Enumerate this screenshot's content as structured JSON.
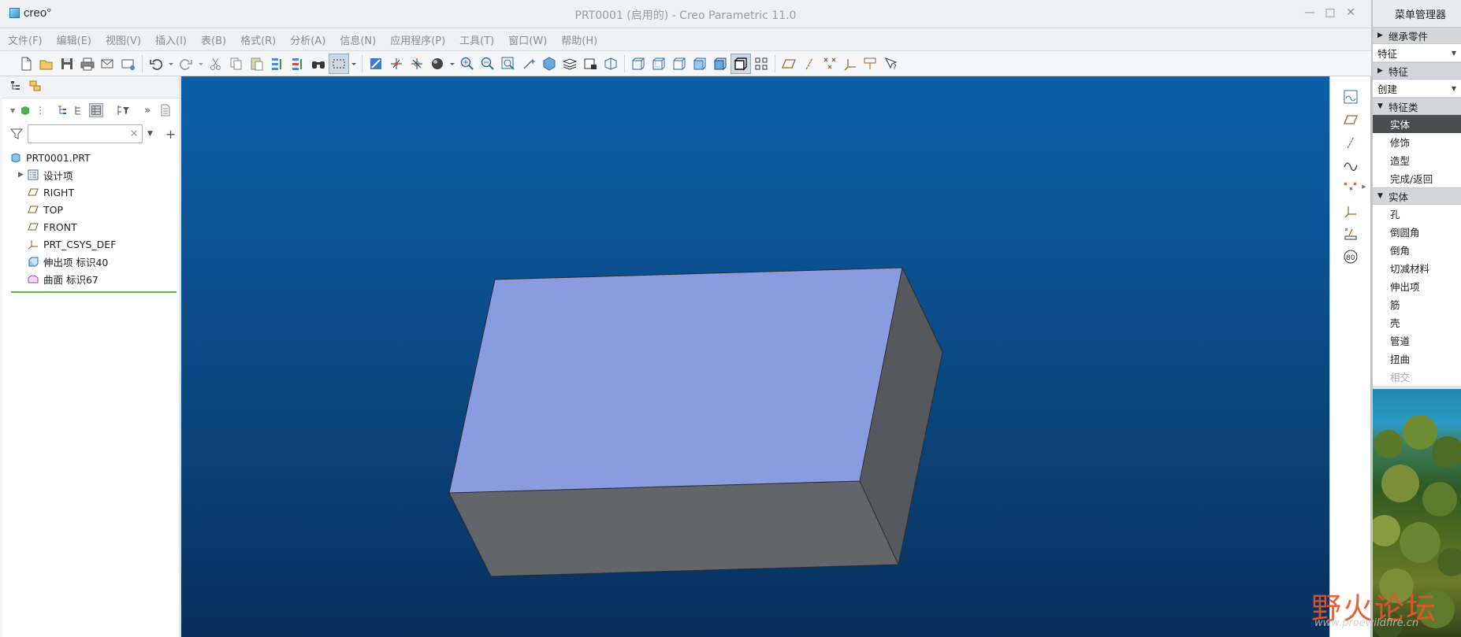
{
  "titlebar": {
    "logo_text": "creo°",
    "title": "PRT0001 (启用的) - Creo Parametric 11.0",
    "minimize": "—",
    "maximize": "□",
    "close": "✕"
  },
  "menubar": {
    "items": [
      "文件(F)",
      "编辑(E)",
      "视图(V)",
      "插入(I)",
      "表(B)",
      "格式(R)",
      "分析(A)",
      "信息(N)",
      "应用程序(P)",
      "工具(T)",
      "窗口(W)",
      "帮助(H)"
    ]
  },
  "tree": {
    "search_placeholder": "",
    "search_clear": "×",
    "add_symbol": "+",
    "more_symbol": "»",
    "nodes": [
      {
        "label": "PRT0001.PRT",
        "icon": "part-icon"
      },
      {
        "label": "设计项",
        "icon": "design-items-icon",
        "expandable": true
      },
      {
        "label": "RIGHT",
        "icon": "datum-plane-icon"
      },
      {
        "label": "TOP",
        "icon": "datum-plane-icon"
      },
      {
        "label": "FRONT",
        "icon": "datum-plane-icon"
      },
      {
        "label": "PRT_CSYS_DEF",
        "icon": "csys-icon"
      },
      {
        "label": "伸出项 标识40",
        "icon": "protrusion-icon"
      },
      {
        "label": "曲面 标识67",
        "icon": "surface-icon"
      }
    ]
  },
  "menu_manager": {
    "title": "菜单管理器",
    "sections": {
      "inherit": "继承零件",
      "feature_combo": "特征",
      "feature": "特征",
      "create_combo": "创建",
      "feature_class": "特征类",
      "solid": "实体"
    },
    "feature_class_items": [
      {
        "label": "实体",
        "selected": true
      },
      {
        "label": "修饰"
      },
      {
        "label": "造型"
      },
      {
        "label": "完成/返回"
      }
    ],
    "solid_items": [
      {
        "label": "孔"
      },
      {
        "label": "倒圆角"
      },
      {
        "label": "倒角"
      },
      {
        "label": "切减材料"
      },
      {
        "label": "伸出项"
      },
      {
        "label": "筋"
      },
      {
        "label": "壳"
      },
      {
        "label": "管道"
      },
      {
        "label": "扭曲"
      },
      {
        "label": "相交",
        "disabled": true
      }
    ]
  },
  "watermark": {
    "text": "野火论坛",
    "url": "www.proewildfire.cn"
  },
  "colors": {
    "box_top": "#8b9be0",
    "box_front": "#62656a",
    "box_side": "#55585d",
    "bg_top": "#0a5fa6",
    "bg_bottom": "#092f5b"
  }
}
